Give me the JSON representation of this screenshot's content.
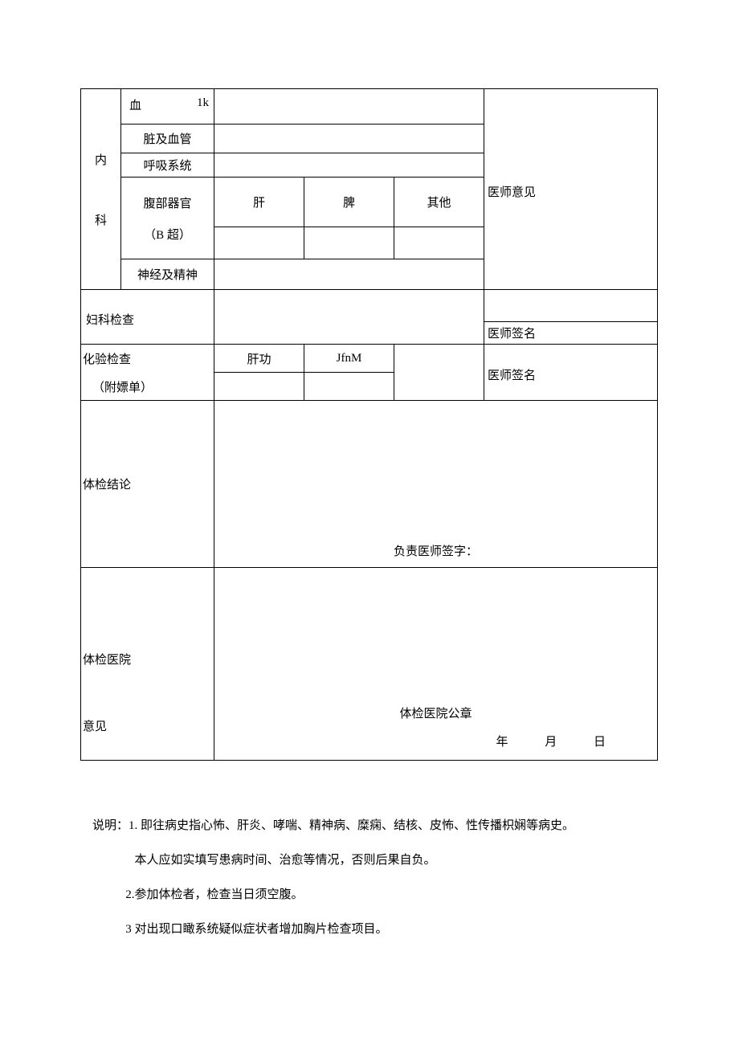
{
  "neike": {
    "section": "内",
    "section2": "科",
    "row1_label_l": "血",
    "row1_label_r": "1k",
    "row2_label": "脏及血管",
    "row3_label": "呼吸系统",
    "row4_label_top": "腹部器官",
    "row4_label_bottom": "（B 超）",
    "row4_c1": "肝",
    "row4_c2": "脾",
    "row4_c3": "其他",
    "row5_label": "神经及精神",
    "opinion": "医师意见"
  },
  "fuke": {
    "label": "妇科检查",
    "sign": "医师签名"
  },
  "lab": {
    "label_top": "化验检查",
    "label_bottom": "（附嫖单）",
    "c1": "肝功",
    "c2": "JfnM",
    "sign": "医师签名"
  },
  "conclusion": {
    "label": "体检结论",
    "footer": "负责医师签字："
  },
  "hospital": {
    "label_top": "体检医院",
    "label_bottom": "意见",
    "seal": "体检医院公章",
    "date_y": "年",
    "date_m": "月",
    "date_d": "日"
  },
  "notes": {
    "n1": "说明：1. 即往病史指心怖、肝炎、哮喘、精神病、糜痫、结核、皮怖、性传播枳娴等病史。",
    "n2": "              本人应如实填写患病时间、治愈等情况，否则后果自负。",
    "n3": "           2.参加体检者，检查当日须空腹。",
    "n4": "           3 对出现口瞰系统疑似症状者增加胸片检查项目。"
  }
}
